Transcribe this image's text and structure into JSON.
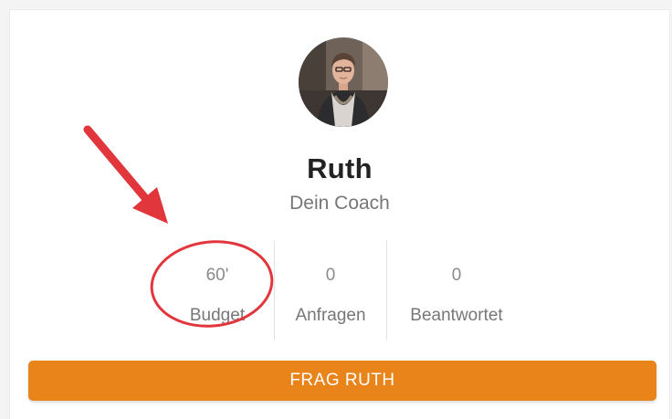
{
  "coach": {
    "name": "Ruth",
    "role": "Dein Coach"
  },
  "stats": [
    {
      "value": "60'",
      "label": "Budget"
    },
    {
      "value": "0",
      "label": "Anfragen"
    },
    {
      "value": "0",
      "label": "Beantwortet"
    }
  ],
  "action": {
    "ask_label": "FRAG RUTH"
  },
  "colors": {
    "button": "#e8841a",
    "annotation": "#e2363d"
  }
}
